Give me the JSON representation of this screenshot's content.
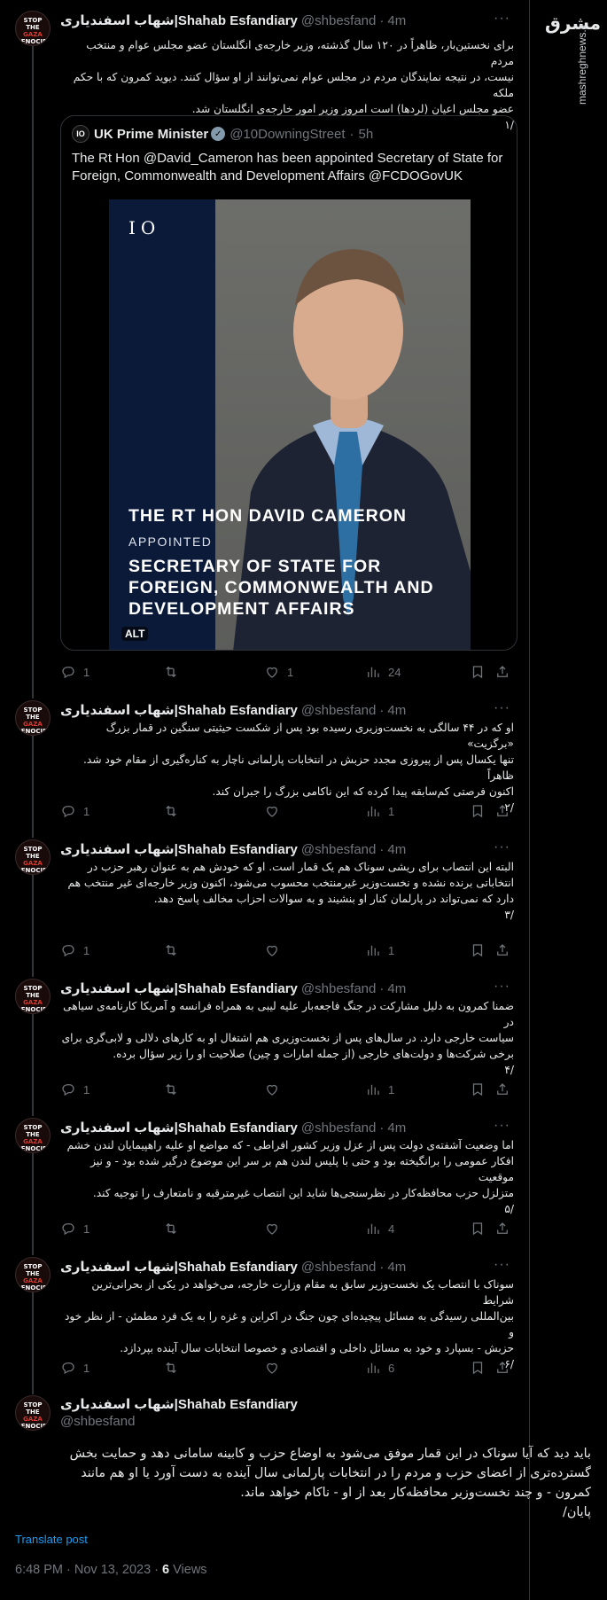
{
  "brand": {
    "logo": "مشرق",
    "site": "mashreghnews.ir"
  },
  "author": {
    "name": "شهاب اسفندیاری|Shahab Esfandiary",
    "handle": "@shbesfand",
    "time": "4m",
    "avatar_lines": [
      "STOP THE",
      "GAZA",
      "GENOCIDE"
    ]
  },
  "quote": {
    "avatar": "IO",
    "name": "UK Prime Minister",
    "handle": "@10DowningStreet",
    "time": "5h",
    "text": "The Rt Hon @David_Cameron has been appointed Secretary of State for Foreign, Commonwealth and Development Affairs @FCDOGovUK",
    "image": {
      "logo": "IO",
      "headline": "THE RT HON DAVID CAMERON",
      "sub": "APPOINTED",
      "role": "SECRETARY OF STATE FOR FOREIGN, COMMONWEALTH AND DEVELOPMENT AFFAIRS",
      "alt": "ALT"
    }
  },
  "tweets": [
    {
      "text": "برای نخستین‌بار، ظاهراً در ۱۲۰ سال گذشته، وزیر خارجه‌ی انگلستان عضو مجلس عوام و منتخب مردم\nنیست، در نتیجه نمایندگان مردم در مجلس عوام نمی‌توانند از او سؤال کنند. دیوید کمرون که با حکم ملکه\nعضو مجلس اعیان (لردها) است امروز وزیر امور خارجه‌ی انگلستان شد.\n/۱",
      "reply": "1",
      "retweet": "",
      "like": "1",
      "views": "24"
    },
    {
      "text": "او که در ۴۴ سالگی به نخست‌وزیری رسیده بود پس از شکست حیثیتی سنگین در قمار بزرگ «برگزیت»\nتنها یکسال پس از پیروزی مجدد حزبش در انتخابات پارلمانی ناچار به کناره‌گیری از مقام خود شد. ظاهراً\nاکنون فرصتی کم‌سابقه پیدا کرده که این ناکامی بزرگ را جبران کند.\n/۲",
      "reply": "1",
      "retweet": "",
      "like": "",
      "views": "1"
    },
    {
      "text": "البته این انتصاب برای ریشی سوناک هم یک قمار است. او که خودش هم به عنوان رهبر حزب در\nانتخاباتی برنده نشده و نخست‌وزیر غیرمنتخب محسوب می‌شود، اکنون وزیر خارجه‌ای غیر منتخب هم\nدارد که نمی‌تواند در پارلمان کنار او بنشیند و به سوالات احزاب مخالف پاسخ دهد.\n/۳",
      "reply": "1",
      "retweet": "",
      "like": "",
      "views": "1"
    },
    {
      "text": "ضمنا کمرون به دلیل مشارکت در جنگ فاجعه‌بار علیه لیبی به همراه فرانسه و آمریکا کارنامه‌ی سیاهی در\nسیاست خارجی دارد. در سال‌های پس از نخست‌وزیری هم اشتغال او به کارهای دلالی و لابی‌گری برای\nبرخی شرکت‌ها و دولت‌های خارجی (از جمله امارات و چین) صلاحیت او را زیر سؤال برده.\n/۴",
      "reply": "1",
      "retweet": "",
      "like": "",
      "views": "1"
    },
    {
      "text": "اما وضعیت آشفته‌ی دولت پس از عزل وزیر کشور افراطی - که مواضع او علیه راهپیمایان لندن خشم\nافکار عمومی را برانگیخته بود و حتی با پلیس لندن هم بر سر این موضوع درگیر شده بود -  و نیز موقعیت\nمتزلزل حزب محافظه‌کار در نظرسنجی‌ها شاید این انتصاب غیرمترقبه و نامتعارف را توجیه کند.\n/۵",
      "reply": "1",
      "retweet": "",
      "like": "",
      "views": "4"
    },
    {
      "text": "سوناک با انتصاب یک نخست‌وزیر سابق به مقام وزارت خارجه، می‌خواهد در یکی از بحرانی‌ترین شرایط\nبین‌المللی رسیدگی به مسائل پیچیده‌ای چون جنگ در اکراین و غزه را به یک فرد مطمئن - از نظر خود و\nحزبش - بسپارد و خود به مسائل داخلی و اقتصادی و خصوصا انتخابات سال آینده بپردازد.\n/۶",
      "reply": "1",
      "retweet": "",
      "like": "",
      "views": "6"
    }
  ],
  "final": {
    "text": "باید دید که آیا سوناک در این قمار موفق می‌شود به اوضاع حزب و کابینه سامانی دهد و حمایت بخش\nگسترده‌تری از اعضای حزب و مردم را در انتخابات پارلمانی سال آینده به دست آورد یا او هم مانند\nکمرون - و چند نخست‌وزیر محافظه‌کار بعد از او - ناکام خواهد ماند.\nپایان/",
    "translate": "Translate post",
    "time": "6:48 PM · Nov 13, 2023 ·",
    "views_count": "6",
    "views_label": "Views"
  },
  "icons": [
    "reply-icon",
    "retweet-icon",
    "like-icon",
    "views-icon",
    "bookmark-icon",
    "share-icon",
    "more-icon",
    "verified-badge-icon"
  ],
  "colors": {
    "link": "#1d9bf0",
    "muted": "#71767b",
    "text": "#e7e9ea",
    "border": "#2f3336"
  }
}
